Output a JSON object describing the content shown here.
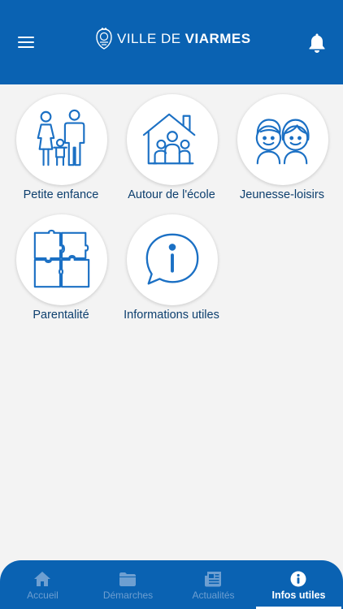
{
  "header": {
    "brand_light": "VILLE DE",
    "brand_bold": "VIARMES",
    "menu_icon": "hamburger-menu-icon",
    "notification_icon": "bell-icon"
  },
  "colors": {
    "primary": "#0a62b2",
    "text_dark": "#0d3f6e",
    "background": "#f3f3f3",
    "tab_inactive": "#6e9fd1"
  },
  "tiles": [
    {
      "label": "Petite enfance",
      "icon": "family-icon"
    },
    {
      "label": "Autour de l'école",
      "icon": "school-house-icon"
    },
    {
      "label": "Jeunesse-loisirs",
      "icon": "kids-faces-icon"
    },
    {
      "label": "Parentalité",
      "icon": "puzzle-icon"
    },
    {
      "label": "Informations utiles",
      "icon": "info-bubble-icon"
    }
  ],
  "tabbar": {
    "active": "Infos utiles",
    "tabs": [
      {
        "label": "Accueil",
        "icon": "home-icon"
      },
      {
        "label": "Démarches",
        "icon": "folder-icon"
      },
      {
        "label": "Actualités",
        "icon": "newspaper-icon"
      },
      {
        "label": "Infos utiles",
        "icon": "info-icon"
      }
    ]
  }
}
